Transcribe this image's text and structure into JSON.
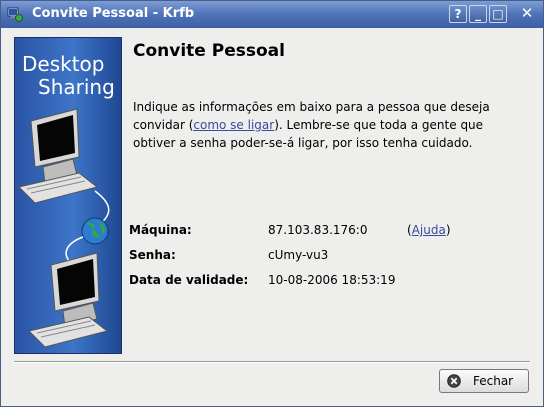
{
  "window": {
    "title": "Convite Pessoal - Krfb"
  },
  "titlebar_buttons": {
    "help": "?",
    "minimize": "_",
    "maximize": "□",
    "close": "✕"
  },
  "banner": {
    "line1": "Desktop",
    "line2": "Sharing"
  },
  "main": {
    "heading": "Convite Pessoal",
    "desc_part1": "Indique as informações em baixo para a pessoa que deseja convidar (",
    "desc_link": "como se ligar",
    "desc_part2": "). Lembre-se que toda a gente que obtiver a senha poder-se-á ligar, por isso tenha cuidado."
  },
  "fields": {
    "machine_label": "Máquina:",
    "machine_value": "87.103.83.176:0",
    "help_open": "(",
    "help_link": "Ajuda",
    "help_close": ")",
    "password_label": "Senha:",
    "password_value": "cUmy-vu3",
    "expiry_label": "Data de validade:",
    "expiry_value": "10-08-2006 18:53:19"
  },
  "footer": {
    "close_label": "Fechar"
  },
  "colors": {
    "titlebar": "#4f73b8",
    "banner": "#2a54a5",
    "link": "#3b4b9e"
  }
}
